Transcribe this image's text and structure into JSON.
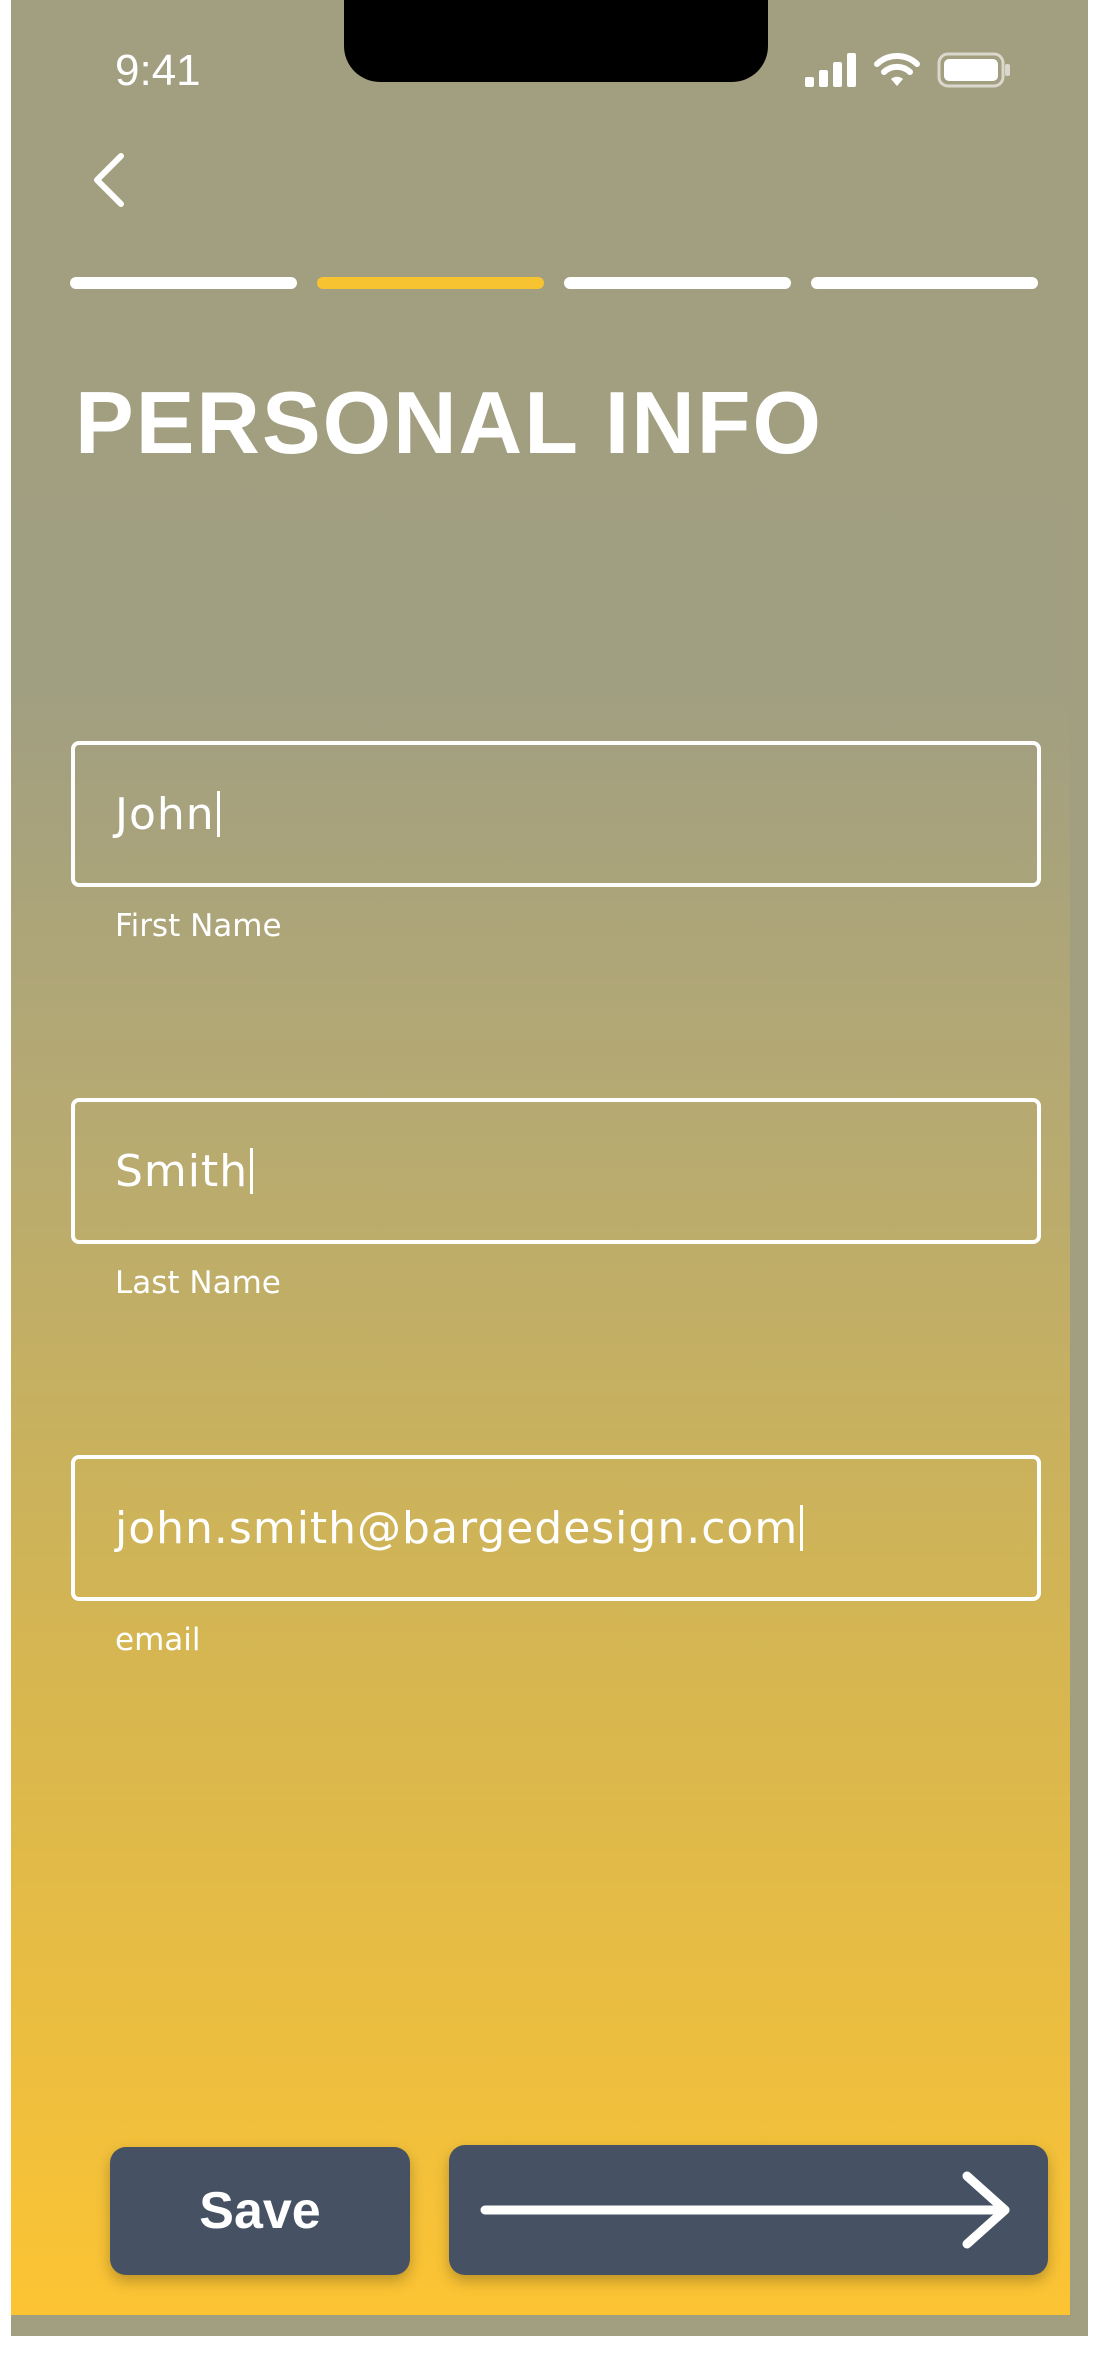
{
  "status_bar": {
    "time": "9:41",
    "icons": [
      "cellular-signal-icon",
      "wifi-icon",
      "battery-icon"
    ]
  },
  "nav": {
    "back_icon": "chevron-left-icon"
  },
  "progress": {
    "steps": 4,
    "current_step": 2,
    "active_color": "#f7c331",
    "inactive_color": "#ffffff"
  },
  "page": {
    "title": "PERSONAL INFO"
  },
  "form": {
    "first_name": {
      "value": "John",
      "label": "First Name"
    },
    "last_name": {
      "value": "Smith",
      "label": "Last Name"
    },
    "email": {
      "value": "john.smith@bargedesign.com",
      "label": "email"
    }
  },
  "actions": {
    "save_label": "Save",
    "next_icon": "arrow-right-icon",
    "button_color": "#465264"
  },
  "colors": {
    "gradient_top": "#a29f80",
    "gradient_bottom": "#fcc433"
  }
}
